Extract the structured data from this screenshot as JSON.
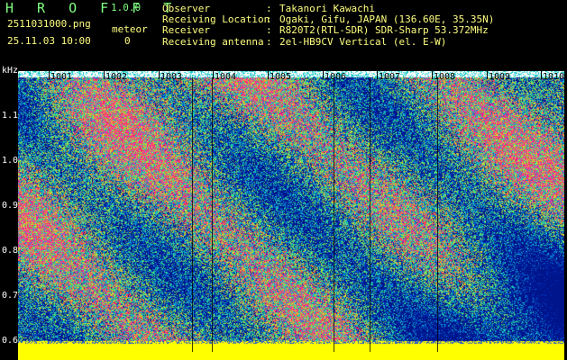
{
  "app": {
    "title": "H R O F F T",
    "version": "1.0.0"
  },
  "file_name": "2511031000.png",
  "timestamp": "25.11.03 10:00",
  "meteor": {
    "label": "meteor",
    "count": "0"
  },
  "info": [
    {
      "label": "Observer",
      "value": "Takanori Kawachi"
    },
    {
      "label": "Receiving Location",
      "value": "Ogaki, Gifu, JAPAN (136.60E, 35.35N)"
    },
    {
      "label": "Receiver",
      "value": "R820T2(RTL-SDR) SDR-Sharp 53.372MHz"
    },
    {
      "label": "Receiving antenna",
      "value": "2el-HB9CV Vertical (el. E-W)"
    }
  ],
  "axis": {
    "unit": "kHz",
    "y_ticks": [
      "1.1",
      "1.0",
      "0.9",
      "0.8",
      "0.7",
      "0.6"
    ],
    "time_labels": [
      "1001",
      "1002",
      "1003",
      "1004",
      "1005",
      "1006",
      "1007",
      "1008",
      "1009",
      "1010"
    ]
  },
  "colors": {
    "background": "#000000",
    "text": "#ffffff",
    "title": "#7fff7f",
    "baseline": "#ffff00",
    "spectrum_low": "#0018a0",
    "spectrum_mid": "#20e0e0",
    "spectrum_high": "#ff2060"
  }
}
